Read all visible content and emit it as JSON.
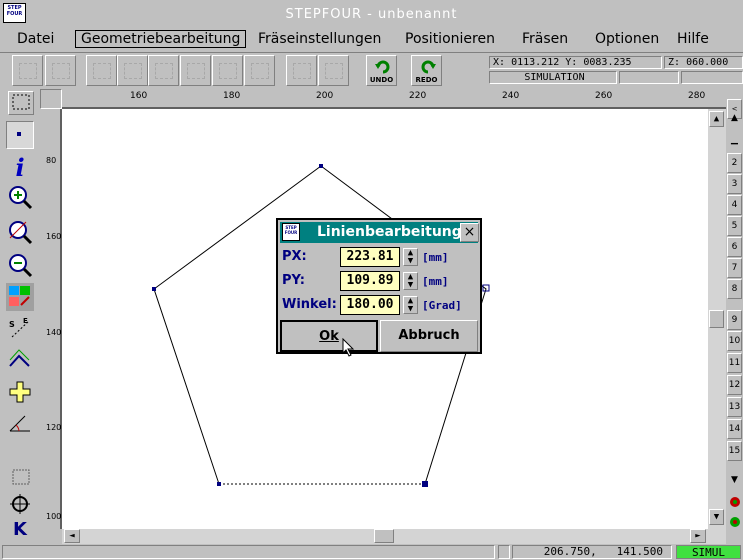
{
  "app": {
    "title": "STEPFOUR - unbenannt",
    "logo_text": "STEP FOUR"
  },
  "menu": [
    "Datei",
    "Geometriebearbeitung",
    "Fräseinstellungen",
    "Positionieren",
    "Fräsen",
    "Optionen",
    "Hilfe"
  ],
  "toolbar": {
    "undo_label": "UNDO",
    "redo_label": "REDO"
  },
  "coords": {
    "x_label": "X:",
    "x_value": "0113.212",
    "y_label": "Y:",
    "y_value": "0083.235",
    "z_label": "Z:",
    "z_value": "060.000",
    "mode": "SIMULATION"
  },
  "ruler_top": [
    "160",
    "180",
    "200",
    "220",
    "240",
    "260",
    "280"
  ],
  "ruler_left": [
    "80",
    "160",
    "140",
    "120",
    "100"
  ],
  "right_panel": [
    "2",
    "3",
    "4",
    "5",
    "6",
    "7",
    "8",
    "9",
    "10",
    "11",
    "12",
    "13",
    "14",
    "15"
  ],
  "dialog": {
    "title": "Linienbearbeitung",
    "close": "×",
    "fields": [
      {
        "label": "PX:",
        "value": "223.81",
        "unit": "[mm]"
      },
      {
        "label": "PY:",
        "value": "109.89",
        "unit": "[mm]"
      },
      {
        "label": "Winkel:",
        "value": "180.00",
        "unit": "[Grad]"
      }
    ],
    "ok": "Ok",
    "cancel": "Abbruch"
  },
  "status": {
    "x": "206.750,",
    "y": "141.500",
    "mode": "SIMUL"
  }
}
